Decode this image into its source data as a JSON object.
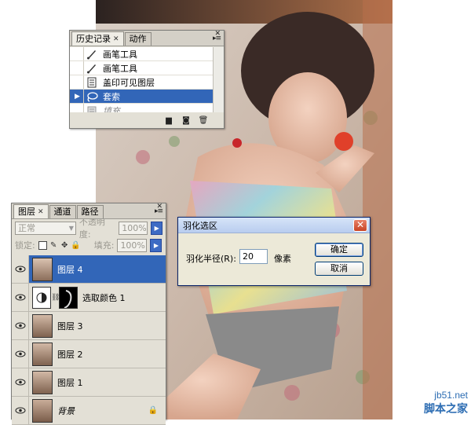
{
  "history_panel": {
    "tabs": [
      {
        "label": "历史记录",
        "active": true
      },
      {
        "label": "动作",
        "active": false
      }
    ],
    "items": [
      {
        "label": "画笔工具",
        "icon": "brush-icon",
        "state": "normal"
      },
      {
        "label": "画笔工具",
        "icon": "brush-icon",
        "state": "normal"
      },
      {
        "label": "盖印可见图层",
        "icon": "stamp-layer-icon",
        "state": "normal"
      },
      {
        "label": "套索",
        "icon": "lasso-icon",
        "state": "selected"
      },
      {
        "label": "填充",
        "icon": "fill-icon",
        "state": "greyed"
      }
    ],
    "footer_icons": [
      "new-document-from-state-icon",
      "new-snapshot-icon",
      "trash-icon"
    ]
  },
  "layers_panel": {
    "tabs": [
      {
        "label": "图层",
        "active": true
      },
      {
        "label": "通道",
        "active": false
      },
      {
        "label": "路径",
        "active": false
      }
    ],
    "blend_mode": "正常",
    "opacity_label": "不透明度:",
    "opacity_value": "100%",
    "lock_label": "锁定:",
    "fill_label": "填充:",
    "fill_value": "100%",
    "layers": [
      {
        "name": "图层 4",
        "type": "pixel",
        "selected": true
      },
      {
        "name": "选取颜色 1",
        "type": "adjustment",
        "selected": false
      },
      {
        "name": "图层 3",
        "type": "pixel",
        "selected": false
      },
      {
        "name": "图层 2",
        "type": "pixel",
        "selected": false
      },
      {
        "name": "图层 1",
        "type": "pixel",
        "selected": false
      },
      {
        "name": "背景",
        "type": "background",
        "selected": false
      }
    ]
  },
  "feather_dialog": {
    "title": "羽化选区",
    "radius_label": "羽化半径(R):",
    "radius_value": "20",
    "unit": "像素",
    "ok_label": "确定",
    "cancel_label": "取消"
  },
  "watermark": {
    "url": "jb51.net",
    "name": "脚本之家"
  },
  "colors": {
    "selection_blue": "#3266b8",
    "panel_grey": "#e3e0d6",
    "arrow_button_blue": "#3d6bc4",
    "close_button_red": "#c84425"
  }
}
